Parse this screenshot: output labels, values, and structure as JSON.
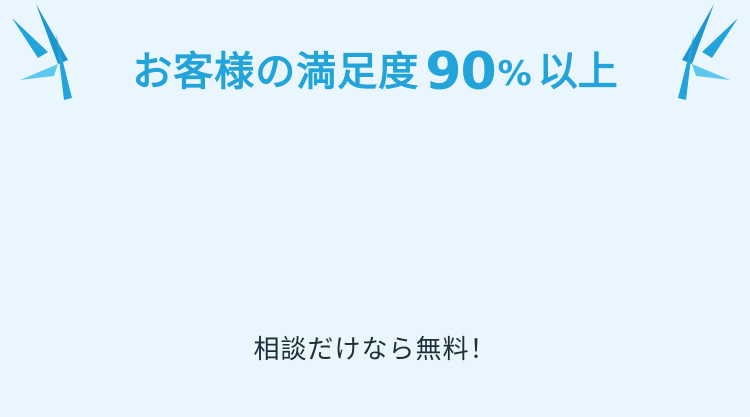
{
  "headline": {
    "prefix": "お客様の満足度",
    "number": "90",
    "percent": "%",
    "suffix": "以上"
  },
  "cta": {
    "text": "相談だけなら無料！"
  },
  "colors": {
    "accent": "#22a3d9",
    "accent_light": "#5cc8ef",
    "background": "#e9f6fd",
    "text_dark": "#1e2d3a"
  },
  "icons": {
    "left": "emphasis-lines-icon",
    "right": "emphasis-lines-icon"
  }
}
